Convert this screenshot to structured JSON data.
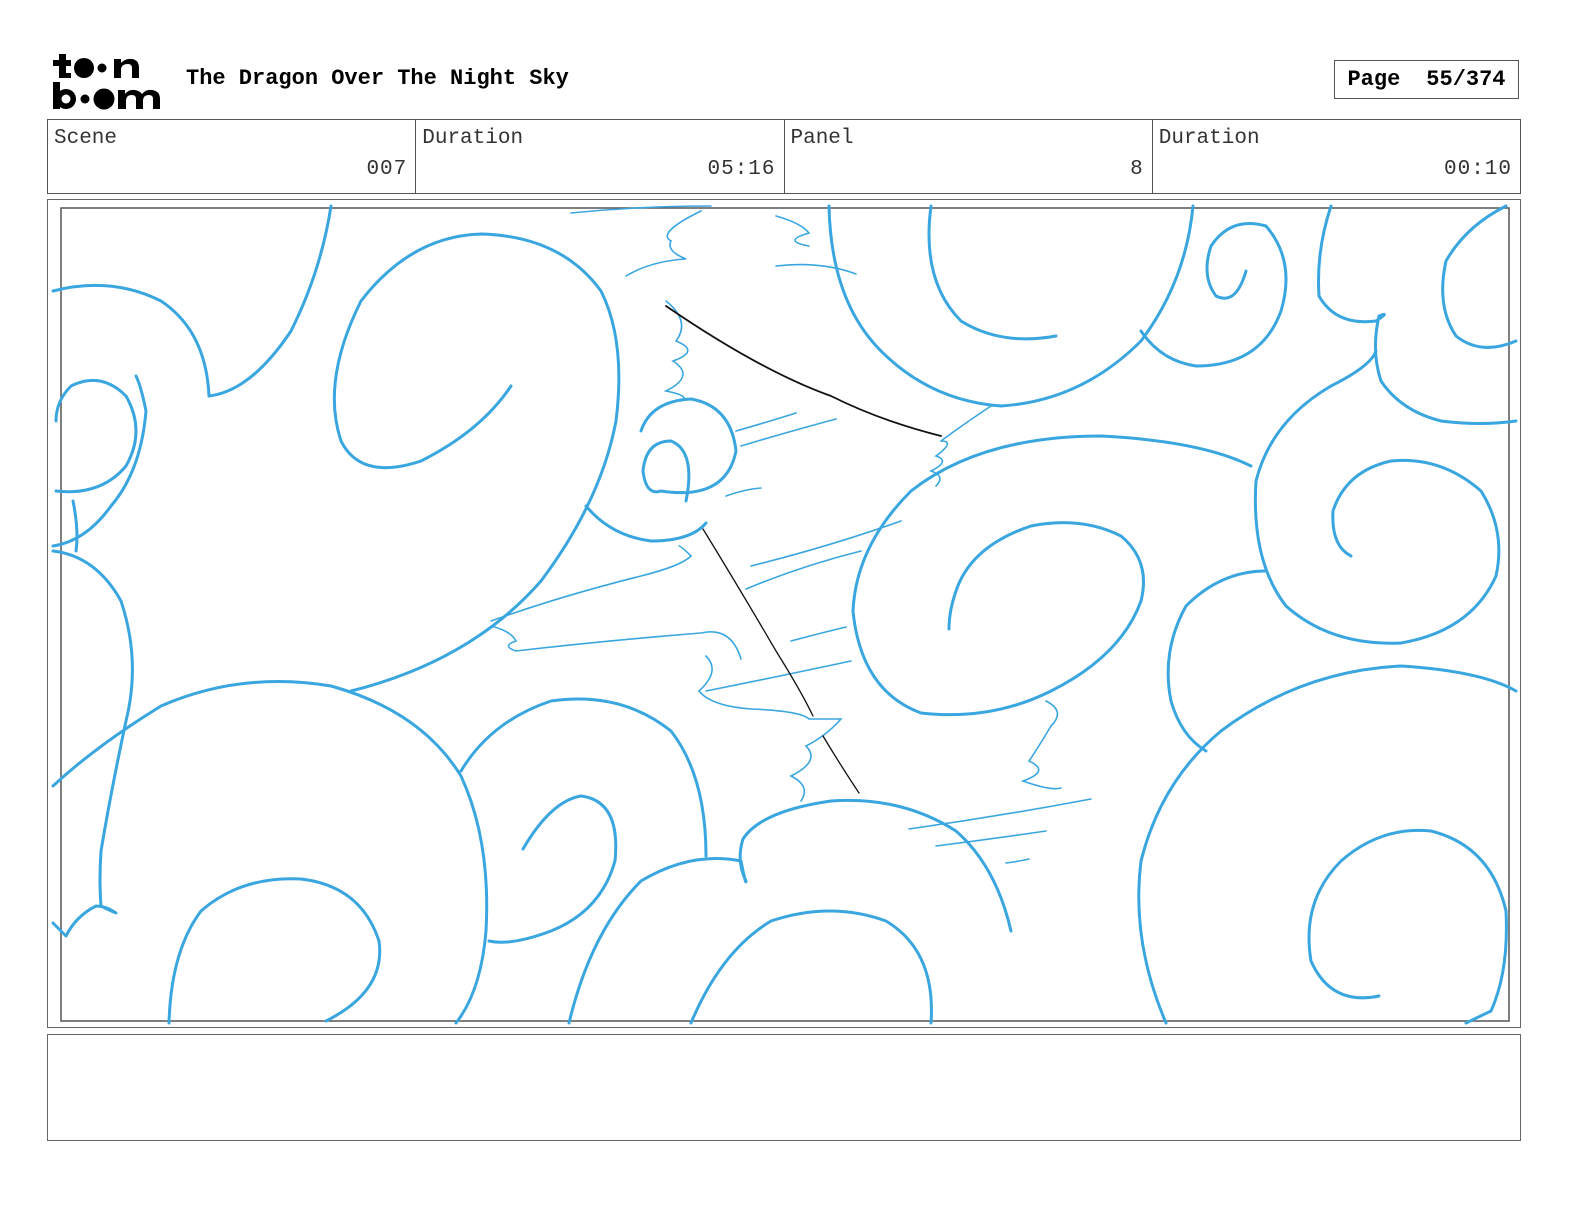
{
  "header": {
    "logo_text": "toonboom",
    "title": "The Dragon Over The Night Sky",
    "page_label": "Page",
    "page_value": "55/374"
  },
  "info": {
    "scene_label": "Scene",
    "scene_value": "007",
    "scene_duration_label": "Duration",
    "scene_duration_value": "05:16",
    "panel_label": "Panel",
    "panel_value": "8",
    "panel_duration_label": "Duration",
    "panel_duration_value": "00:10"
  },
  "drawing": {
    "stroke_color": "#3aa6e0",
    "line_color": "#111111",
    "frame_color": "#555555"
  },
  "notes": {
    "text": ""
  }
}
